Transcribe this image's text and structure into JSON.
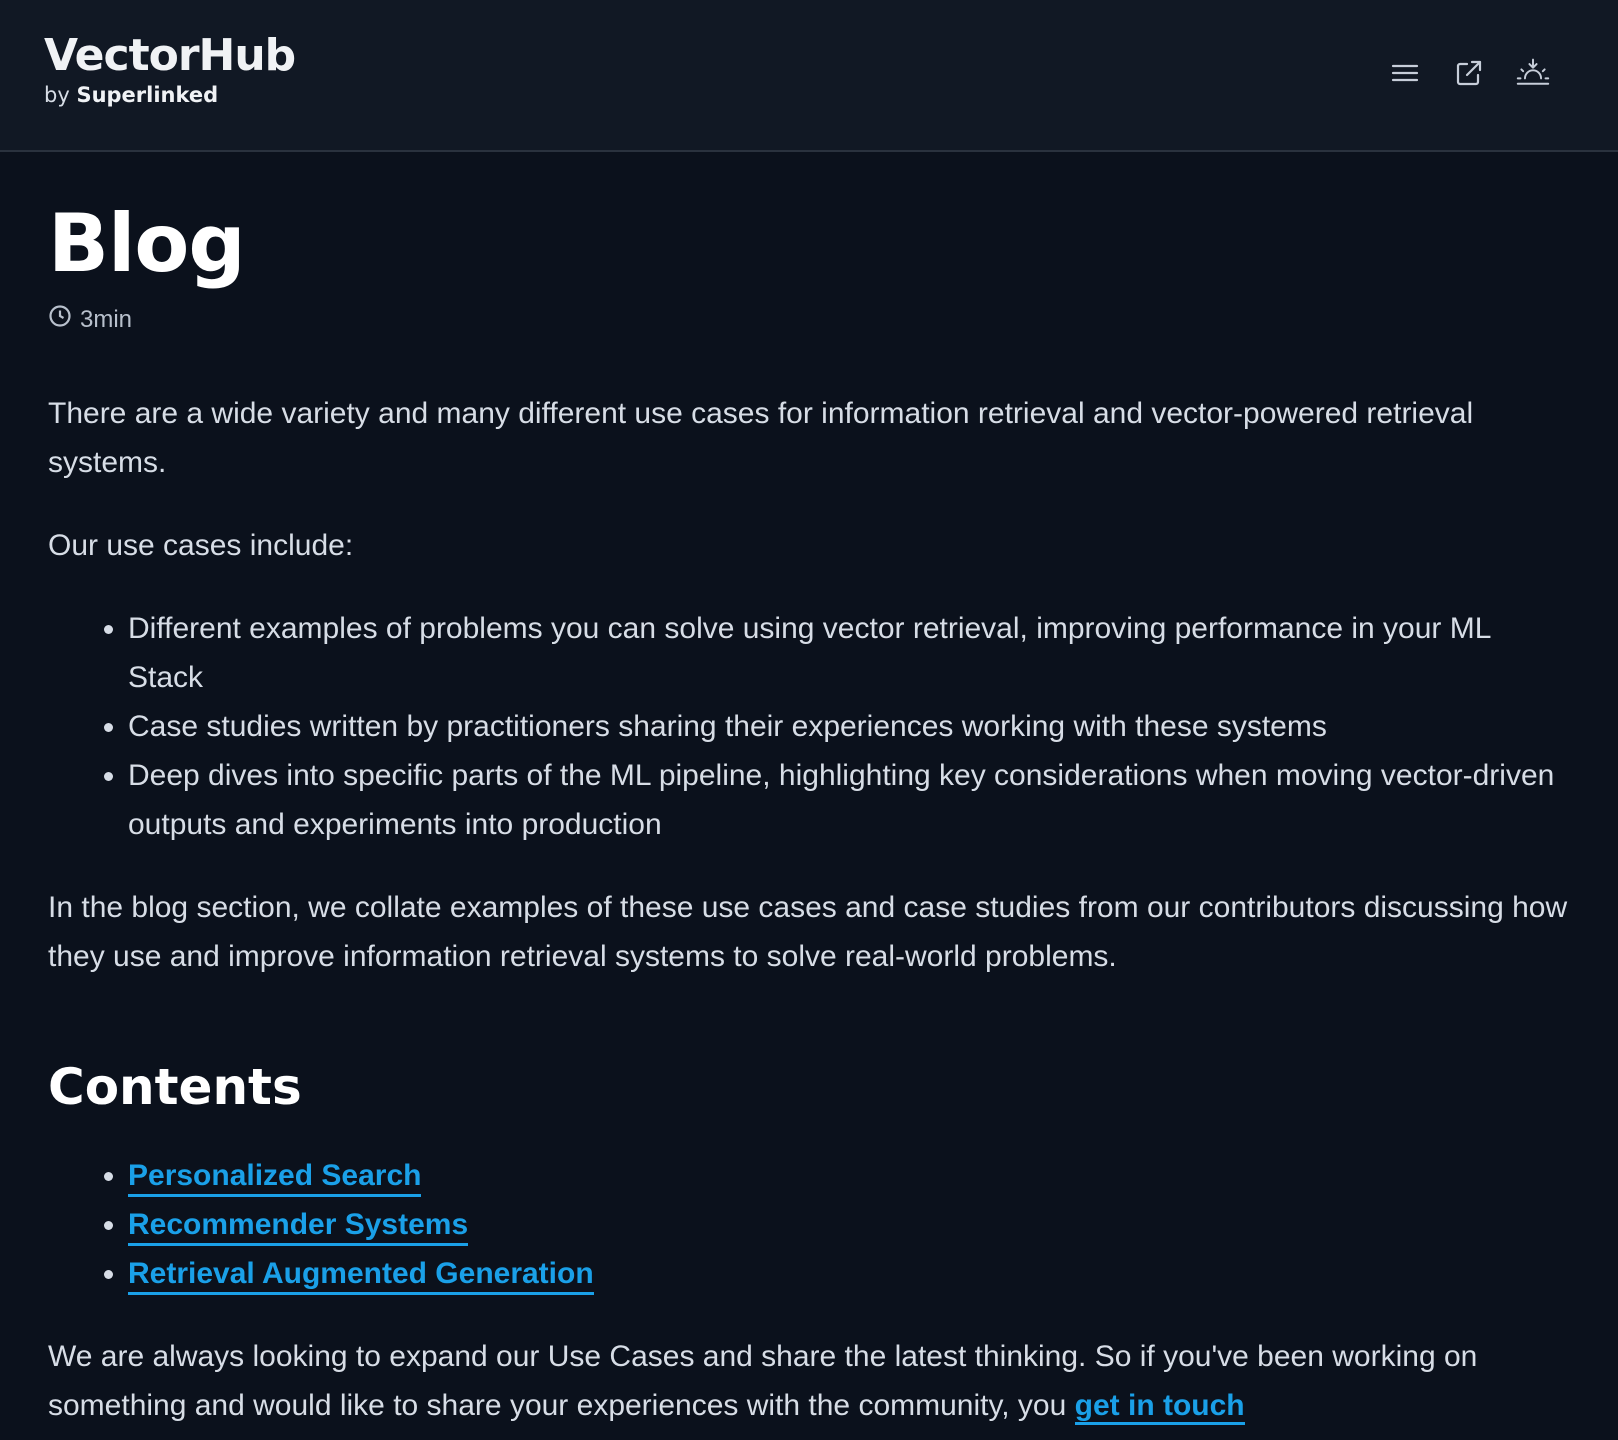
{
  "header": {
    "brand_title": "VectorHub",
    "brand_by": "by",
    "brand_owner": "Superlinked",
    "icons": [
      "menu-icon",
      "external-link-icon",
      "theme-toggle-icon"
    ]
  },
  "article": {
    "title": "Blog",
    "read_time": "3min",
    "intro": "There are a wide variety and many different use cases for information retrieval and vector-powered retrieval systems.",
    "use_cases_lead": "Our use cases include:",
    "use_cases": [
      "Different examples of problems you can solve using vector retrieval, improving performance in your ML Stack",
      "Case studies written by practitioners sharing their experiences working with these systems",
      "Deep dives into specific parts of the ML pipeline, highlighting key considerations when moving vector-driven outputs and experiments into production"
    ],
    "blog_section": "In the blog section, we collate examples of these use cases and case studies from our contributors discussing how they use and improve information retrieval systems to solve real-world problems.",
    "contents_title": "Contents",
    "contents_links": [
      "Personalized Search",
      "Recommender Systems",
      "Retrieval Augmented Generation"
    ],
    "closing_text": "We are always looking to expand our Use Cases and share the latest thinking. So if you've been working on something and would like to share your experiences with the community, you",
    "closing_link": "get in touch"
  },
  "colors": {
    "background": "#0b111c",
    "header_bg": "#111824",
    "link": "#1aa0e8",
    "text": "#d7dde6"
  }
}
